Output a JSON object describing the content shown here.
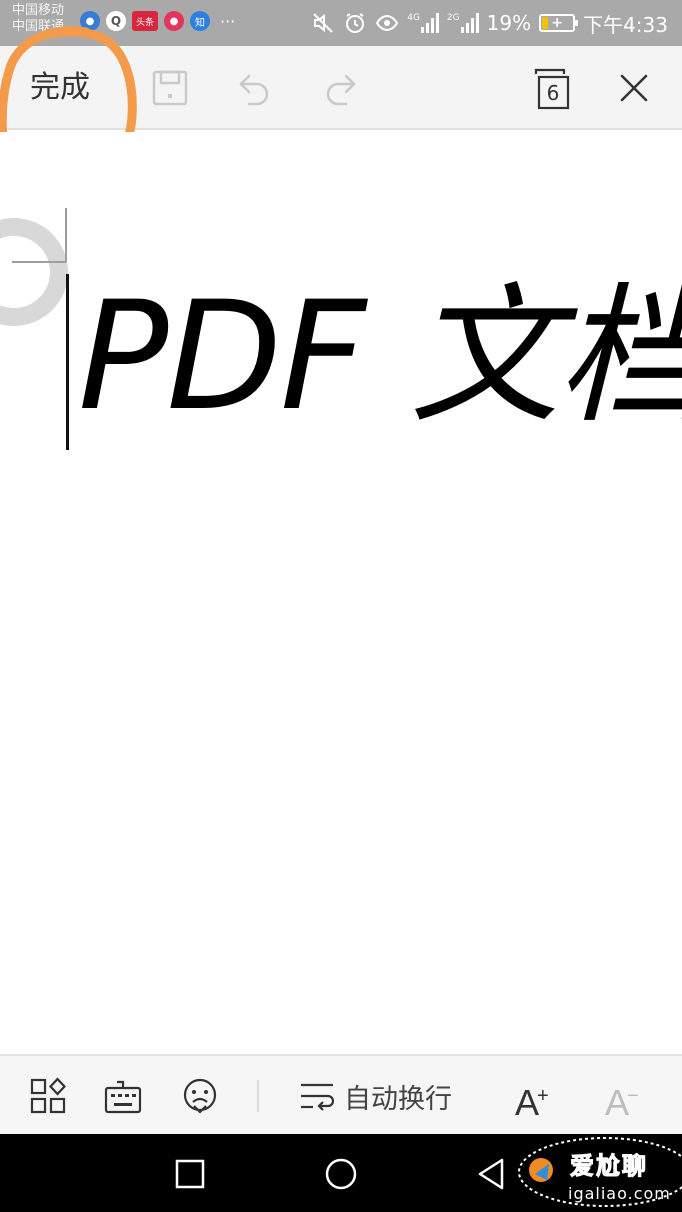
{
  "status_bar": {
    "carrier_line1": "中国移动",
    "carrier_line2": "中国联通",
    "notif_icons": [
      "browser-icon",
      "qq-icon",
      "toutiao-icon",
      "music-icon",
      "zhihu-icon"
    ],
    "toutiao_label": "头条",
    "zhihu_label": "知",
    "more": "···",
    "network_4g": "4G",
    "network_2g": "2G",
    "battery_percent": "19%",
    "battery_level": 0.19,
    "time": "下午4:33",
    "colors": {
      "bar_bg": "#a9a9a9",
      "battery_fill": "#f2c200"
    }
  },
  "toolbar": {
    "done_label": "完成",
    "page_count": "6",
    "icons": [
      "save-icon",
      "undo-icon",
      "redo-icon",
      "page-count-icon",
      "close-icon"
    ],
    "annotation_color": "#f39a4b"
  },
  "document": {
    "text": "PDF 文档"
  },
  "bottom_toolbar": {
    "icons": [
      "apps-icon",
      "keyboard-icon",
      "emoji-icon",
      "wrap-icon"
    ],
    "wrap_label": "自动换行",
    "font_increase": "A",
    "font_increase_sign": "+",
    "font_decrease": "A",
    "font_decrease_sign": "−"
  },
  "nav_bar": {
    "buttons": [
      "recent-apps-icon",
      "home-icon",
      "back-icon"
    ]
  },
  "watermark": {
    "text_cn": "爱尬聊",
    "text_en": "igaliao.com"
  }
}
